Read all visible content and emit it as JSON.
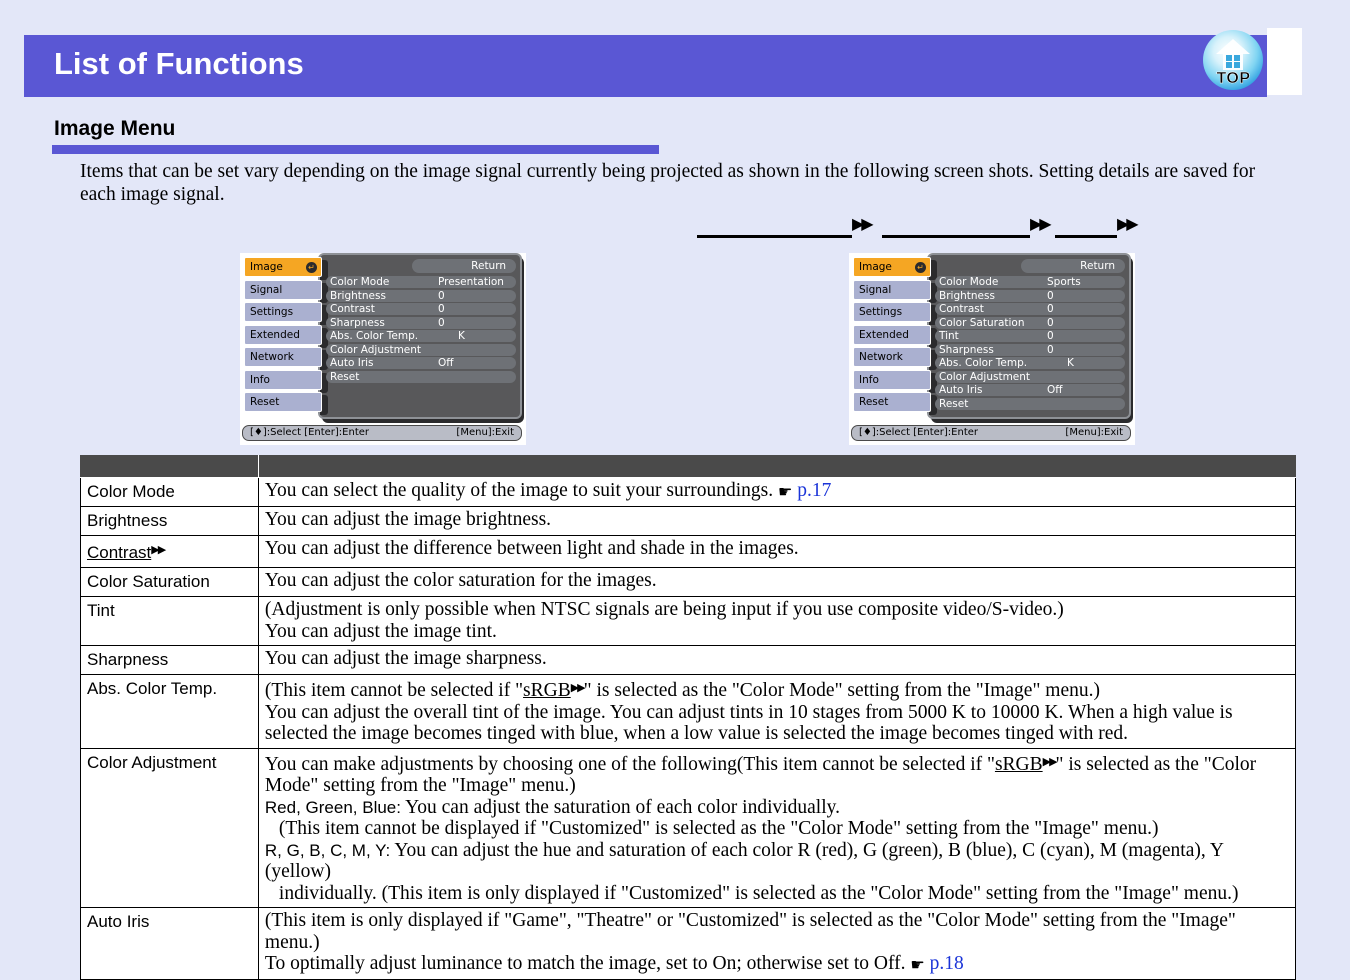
{
  "header": {
    "title": "List of Functions",
    "logo_label": "TOP",
    "logo_icon": "home-house-icon"
  },
  "section": {
    "title": "Image Menu",
    "intro": "Items that can be set vary depending on the image signal currently being projected as shown in the following screen shots. Setting details are saved for each image signal."
  },
  "flow_arrows": {
    "arrow_glyph": "▶▶",
    "count": 3
  },
  "osd_left": {
    "sidebar": [
      "Image",
      "Signal",
      "Settings",
      "Extended",
      "Network",
      "Info",
      "Reset"
    ],
    "active_index": 0,
    "enter_glyph": "↵",
    "return_label": "Return",
    "rows": [
      {
        "label": "Color Mode",
        "value": "Presentation"
      },
      {
        "label": "Brightness",
        "value": "0"
      },
      {
        "label": "Contrast",
        "value": "0"
      },
      {
        "label": "Sharpness",
        "value": "0"
      },
      {
        "label": "Abs. Color Temp.",
        "value": "K"
      },
      {
        "label": "Color Adjustment",
        "value": ""
      },
      {
        "label": "Auto Iris",
        "value": "Off"
      },
      {
        "label": "Reset",
        "value": ""
      }
    ],
    "status_left": "[♦]:Select  [Enter]:Enter",
    "status_right": "[Menu]:Exit"
  },
  "osd_right": {
    "sidebar": [
      "Image",
      "Signal",
      "Settings",
      "Extended",
      "Network",
      "Info",
      "Reset"
    ],
    "active_index": 0,
    "enter_glyph": "↵",
    "return_label": "Return",
    "rows": [
      {
        "label": "Color Mode",
        "value": "Sports"
      },
      {
        "label": "Brightness",
        "value": "0"
      },
      {
        "label": "Contrast",
        "value": "0"
      },
      {
        "label": "Color Saturation",
        "value": "0"
      },
      {
        "label": "Tint",
        "value": "0"
      },
      {
        "label": "Sharpness",
        "value": "0"
      },
      {
        "label": "Abs. Color Temp.",
        "value": "K"
      },
      {
        "label": "Color Adjustment",
        "value": ""
      },
      {
        "label": "Auto Iris",
        "value": "Off"
      },
      {
        "label": "Reset",
        "value": ""
      }
    ],
    "status_left": "[♦]:Select  [Enter]:Enter",
    "status_right": "[Menu]:Exit"
  },
  "table": {
    "header": {
      "col_item": "",
      "col_desc": ""
    },
    "rows": [
      {
        "item": "Color Mode",
        "item_gloss": false,
        "desc_lines": [
          {
            "text": "You can select the quality of the image to suit your surroundings. ",
            "link": "p.17"
          }
        ]
      },
      {
        "item": "Brightness",
        "item_gloss": false,
        "desc_lines": [
          {
            "text": "You can adjust the image brightness."
          }
        ]
      },
      {
        "item": "Contrast",
        "item_gloss": true,
        "desc_lines": [
          {
            "text": "You can adjust the difference between light and shade in the images."
          }
        ]
      },
      {
        "item": "Color Saturation",
        "item_gloss": false,
        "desc_lines": [
          {
            "text": "You can adjust the color saturation for the images."
          }
        ]
      },
      {
        "item": "Tint",
        "item_gloss": false,
        "desc_lines": [
          {
            "text": "(Adjustment is only possible when NTSC signals are being input if you use composite video/S-video.)"
          },
          {
            "text": "You can adjust the image tint."
          }
        ]
      },
      {
        "item": "Sharpness",
        "item_gloss": false,
        "desc_lines": [
          {
            "text": "You can adjust the image sharpness."
          }
        ]
      },
      {
        "item": "Abs. Color Temp.",
        "item_gloss": false,
        "desc_lines": [
          {
            "pre": "(This item cannot be selected if \"",
            "term": "sRGB",
            "post": "\" is selected as the \"Color Mode\" setting from the \"Image\" menu.)"
          },
          {
            "text": "You can adjust the overall tint of the image. You can adjust tints in 10 stages from 5000 K to 10000 K. When a high value is selected the image becomes tinged with blue, when a low value is selected the image becomes tinged with red."
          }
        ]
      },
      {
        "item": "Color Adjustment",
        "item_gloss": false,
        "desc_lines": [
          {
            "pre": "You can make adjustments by choosing one of the following(This item cannot be selected if \"",
            "term": "sRGB",
            "post": "\" is selected as the \"Color Mode\" setting from the \"Image\" menu.)"
          },
          {
            "sans": "Red, Green, Blue:",
            "text": " You can adjust the saturation of each color individually."
          },
          {
            "indent": true,
            "text": "(This item cannot be displayed if \"Customized\" is selected as the \"Color Mode\" setting from the \"Image\" menu.)"
          },
          {
            "sans": "R, G, B, C, M, Y:",
            "text": " You can adjust the hue and saturation of each color R (red), G (green), B (blue), C (cyan), M (magenta), Y (yellow)"
          },
          {
            "indent": true,
            "text": "individually. (This item is only displayed if \"Customized\" is selected as the \"Color Mode\" setting from the \"Image\" menu.)"
          }
        ]
      },
      {
        "item": "Auto Iris",
        "item_gloss": false,
        "desc_lines": [
          {
            "text": "(This item is only displayed if \"Game\", \"Theatre\" or \"Customized\" is selected as the \"Color Mode\" setting from the \"Image\" menu.)"
          },
          {
            "text": "To optimally adjust luminance to match the image, set to On; otherwise set to Off. ",
            "link": "p.18"
          }
        ]
      }
    ]
  },
  "colors": {
    "page_bg": "#e3e7f8",
    "accent": "#5a57d4",
    "link": "#1a34d8",
    "osd_bg": "#58585a",
    "osd_active": "#f5a623",
    "osd_sidebar": "#aab0d0",
    "table_header": "#4a4a4a"
  }
}
